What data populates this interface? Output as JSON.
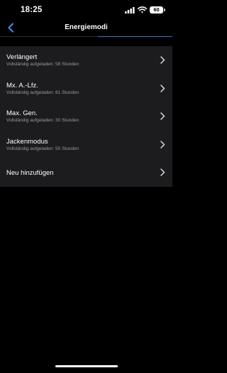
{
  "status_bar": {
    "time": "18:25",
    "battery": "60"
  },
  "nav": {
    "title": "Energiemodi",
    "back_icon": "chevron-left-icon"
  },
  "list": {
    "items": [
      {
        "title": "Verlängert",
        "subtitle": "Vollständig aufgeladen: 58 Stunden"
      },
      {
        "title": "Mx. A.-Lfz.",
        "subtitle": "Vollständig aufgeladen: 81 Stunden"
      },
      {
        "title": "Max. Gen.",
        "subtitle": "Vollständig aufgeladen: 30 Stunden"
      },
      {
        "title": "Jackenmodus",
        "subtitle": "Vollständig aufgeladen: 50 Stunden"
      }
    ],
    "add_label": "Neu hinzufügen"
  },
  "colors": {
    "background": "#000000",
    "list_background": "#1c1c1e",
    "accent": "#3d72c8",
    "subtitle": "#9a9a9a"
  }
}
